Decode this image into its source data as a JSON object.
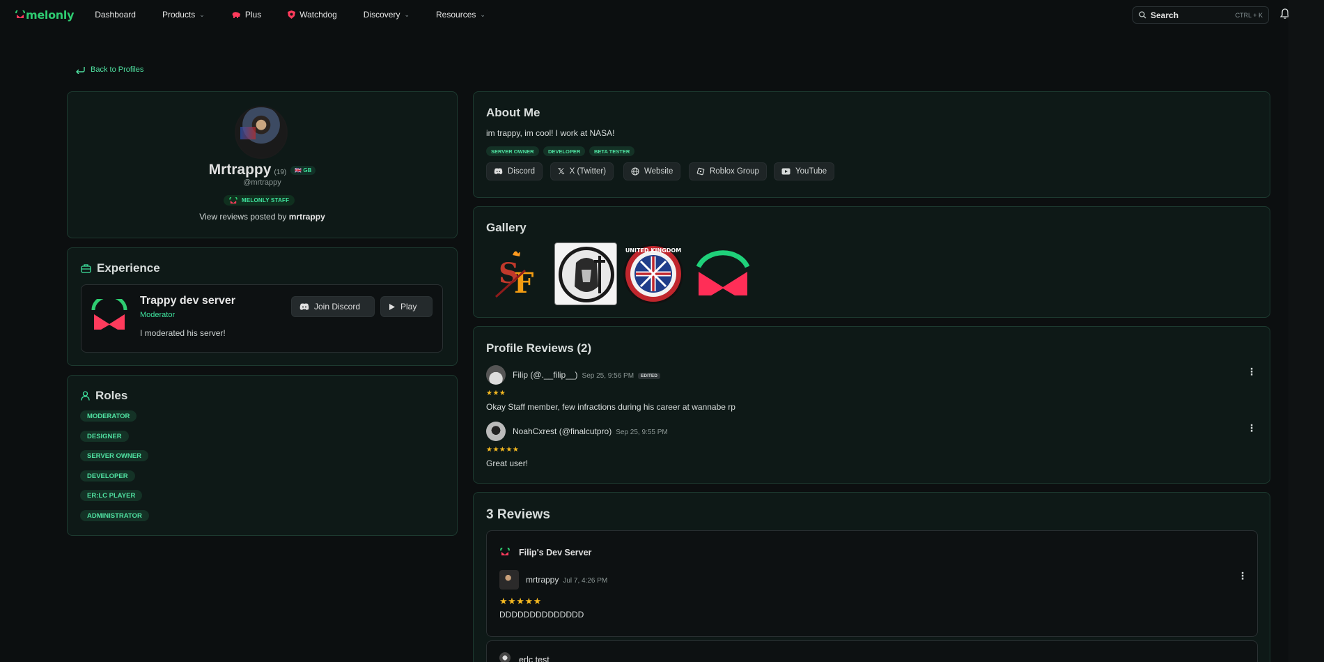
{
  "nav": {
    "logo": "melonly",
    "items": [
      {
        "label": "Dashboard"
      },
      {
        "label": "Products"
      },
      {
        "label": "Plus"
      },
      {
        "label": "Watchdog"
      },
      {
        "label": "Discovery"
      },
      {
        "label": "Resources"
      }
    ],
    "search_label": "Search",
    "search_shortcut": "CTRL + K"
  },
  "back_label": "Back to Profiles",
  "profile": {
    "name": "Mrtrappy",
    "age": "(19)",
    "country": "GB",
    "handle": "@mrtrappy",
    "staff_badge": "MELONLY STAFF",
    "view_prefix": "View reviews posted by ",
    "view_user": "mrtrappy"
  },
  "experience": {
    "title": "Experience",
    "server": "Trappy dev server",
    "role": "Moderator",
    "desc": "I moderated his server!",
    "join_label": "Join Discord",
    "play_label": "Play"
  },
  "roles": {
    "title": "Roles",
    "items": [
      "MODERATOR",
      "DESIGNER",
      "SERVER OWNER",
      "DEVELOPER",
      "ER:LC PLAYER",
      "ADMINISTRATOR"
    ]
  },
  "about": {
    "title": "About Me",
    "text": "im trappy, im cool! I work at NASA!",
    "tags": [
      "SERVER OWNER",
      "DEVELOPER",
      "BETA TESTER"
    ],
    "links": [
      "Discord",
      "X (Twitter)",
      "Website",
      "Roblox Group",
      "YouTube"
    ]
  },
  "gallery": {
    "title": "Gallery",
    "seal_text": "UNITED KINGDOM"
  },
  "profile_reviews": {
    "title": "Profile Reviews (2)",
    "items": [
      {
        "author": "Filip (@.__filip__)",
        "time": "Sep 25, 9:56 PM",
        "edited": "EDITED",
        "stars": "★★★",
        "text": "Okay Staff member, few infractions during his career at wannabe rp"
      },
      {
        "author": "NoahCxrest (@finalcutpro)",
        "time": "Sep 25, 9:55 PM",
        "stars": "★★★★★",
        "text": "Great user!"
      }
    ]
  },
  "reviews": {
    "title": "3 Reviews",
    "items": [
      {
        "server": "Filip's Dev Server",
        "author": "mrtrappy",
        "time": "Jul 7, 4:26 PM",
        "stars": "★★★★★",
        "text": "DDDDDDDDDDDDDD"
      },
      {
        "server": "erlc test"
      }
    ]
  },
  "colors": {
    "accent": "#3fe39e",
    "brand_red": "#ff3b5c",
    "star": "#f5b921"
  }
}
